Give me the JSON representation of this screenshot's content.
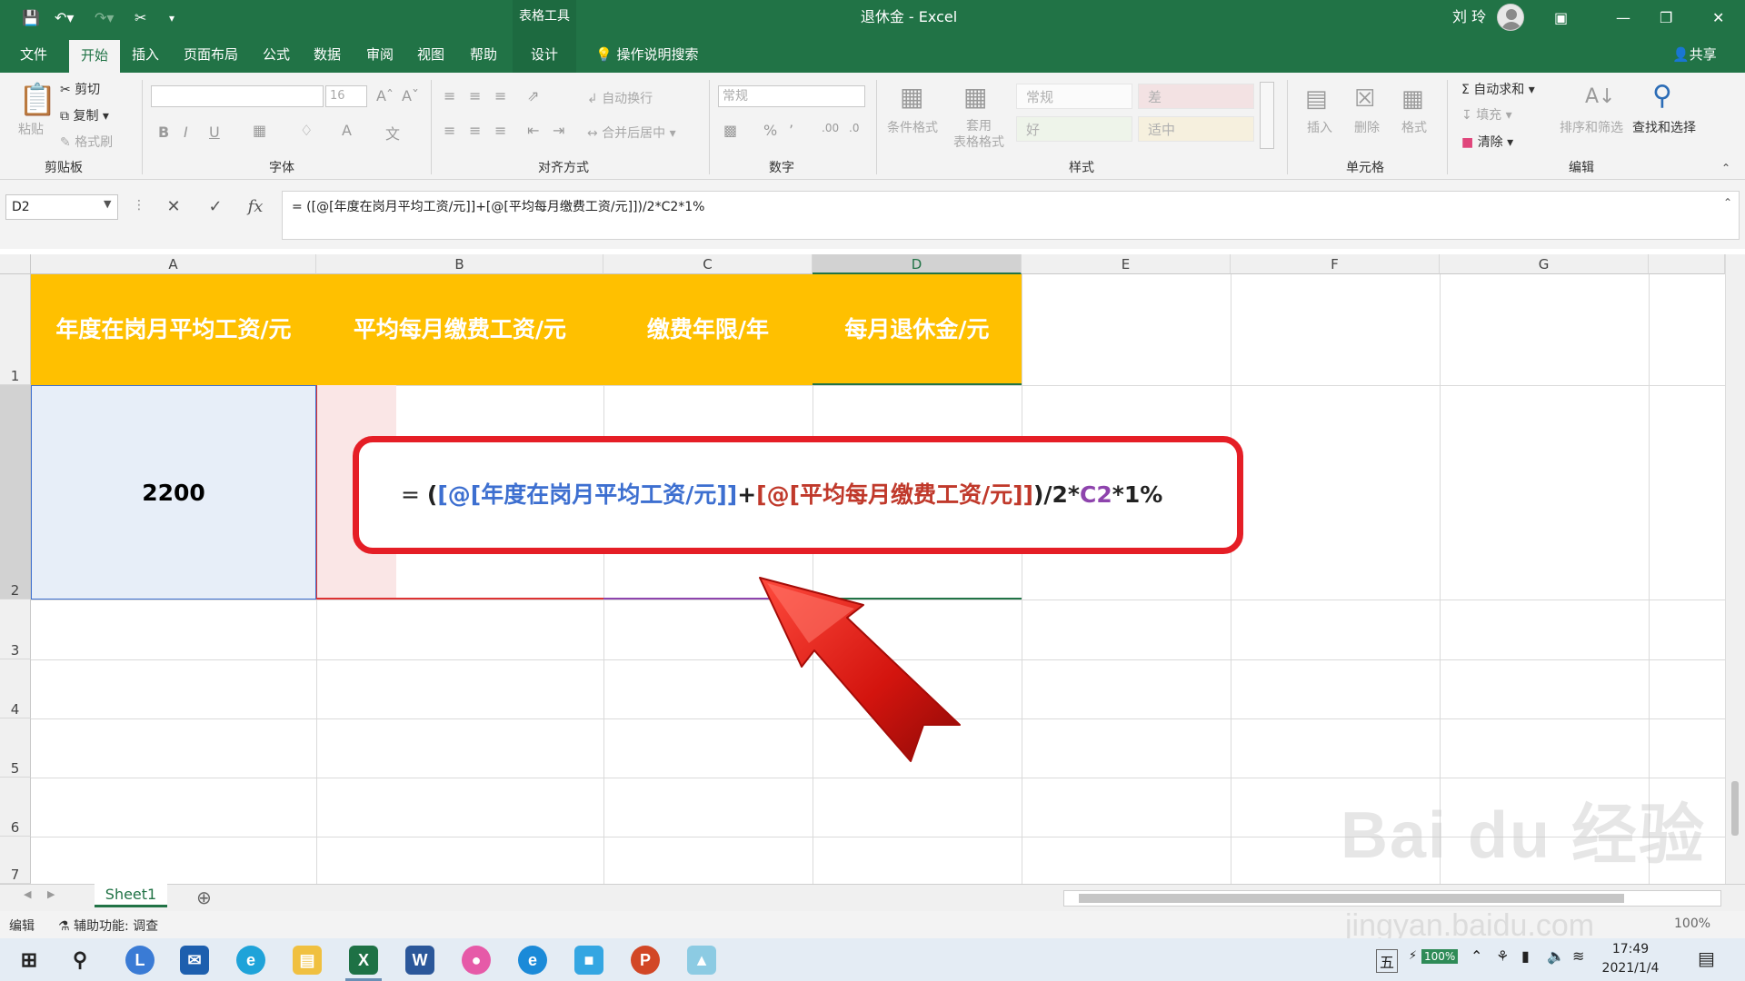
{
  "titlebar": {
    "context_group": "表格工具",
    "title": "退休金 - Excel",
    "user": "刘 玲"
  },
  "tabs": [
    {
      "label": "文件"
    },
    {
      "label": "开始"
    },
    {
      "label": "插入"
    },
    {
      "label": "页面布局"
    },
    {
      "label": "公式"
    },
    {
      "label": "数据"
    },
    {
      "label": "审阅"
    },
    {
      "label": "视图"
    },
    {
      "label": "帮助"
    },
    {
      "label": "设计"
    }
  ],
  "tell_me": "操作说明搜索",
  "share": "共享",
  "ribbon": {
    "clipboard": {
      "paste": "粘贴",
      "cut": "剪切",
      "copy": "复制",
      "format_painter": "格式刷",
      "label": "剪贴板"
    },
    "font": {
      "size": "16",
      "label": "字体"
    },
    "alignment": {
      "wrap": "自动换行",
      "merge": "合并后居中",
      "label": "对齐方式"
    },
    "number": {
      "format": "常规",
      "label": "数字"
    },
    "styles": {
      "conditional": "条件格式",
      "table_format": "套用\n表格格式",
      "cells": [
        "常规",
        "差",
        "好",
        "适中"
      ],
      "label": "样式"
    },
    "cells": {
      "insert": "插入",
      "delete": "删除",
      "format": "格式",
      "label": "单元格"
    },
    "editing": {
      "autosum": "自动求和",
      "fill": "填充",
      "clear": "清除",
      "sort": "排序和筛选",
      "find": "查找和选择",
      "label": "编辑"
    }
  },
  "formula_bar": {
    "name_box": "D2",
    "formula": "= ([@[年度在岗月平均工资/元]]+[@[平均每月缴费工资/元]])/2*C2*1%"
  },
  "columns": [
    "A",
    "B",
    "C",
    "D",
    "E",
    "F",
    "G"
  ],
  "rows": [
    "1",
    "2",
    "3",
    "4",
    "5",
    "6",
    "7"
  ],
  "table": {
    "headers": [
      "年度在岗月平均工资/元",
      "平均每月缴费工资/元",
      "缴费年限/年",
      "每月退休金/元"
    ],
    "a2": "2200"
  },
  "callout": {
    "eq": "= ",
    "open": "(",
    "ref1": "[@[年度在岗月平均工资/元]]",
    "plus": "+",
    "ref2": "[@[平均每月缴费工资/元]]",
    "mid": ")/2*",
    "ref3": "C2",
    "tail": "*1%"
  },
  "sheet": {
    "tab": "Sheet1"
  },
  "status": {
    "mode": "编辑",
    "accessibility": "辅助功能: 调查",
    "zoom": "100%"
  },
  "taskbar": {
    "ime": "五",
    "battery": "100%",
    "time": "17:49",
    "date": "2021/1/4"
  },
  "watermark": {
    "brand": "Bai du 经验",
    "url": "jingyan.baidu.com"
  }
}
